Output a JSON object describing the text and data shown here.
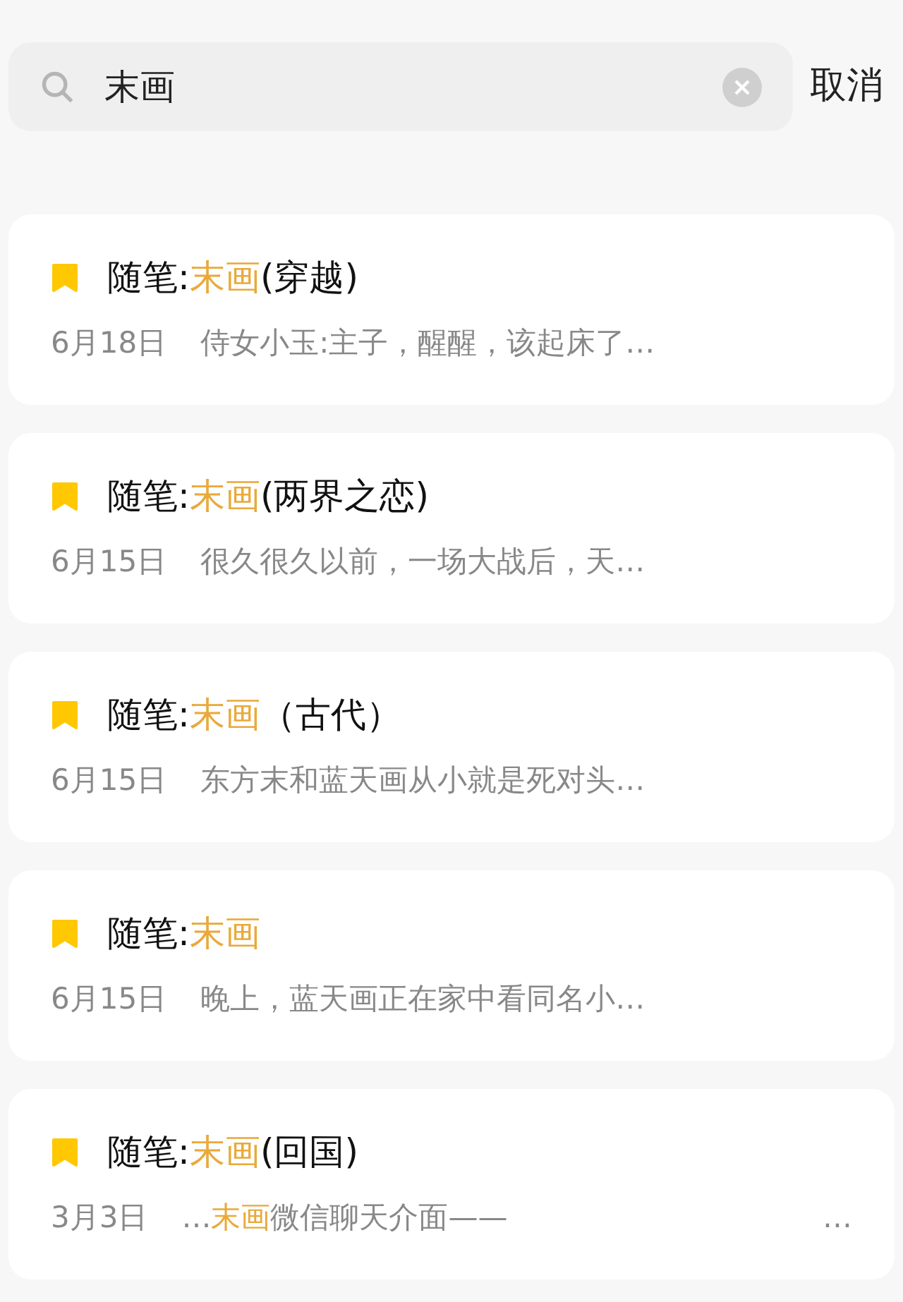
{
  "search": {
    "value": "末画",
    "cancel": "取消"
  },
  "results": [
    {
      "title": [
        {
          "text": "随笔:",
          "highlight": false
        },
        {
          "text": "末画",
          "highlight": true
        },
        {
          "text": "(穿越)",
          "highlight": false
        }
      ],
      "date": "6月18日",
      "snippet": [
        {
          "text": "侍女小玉:主子，醒醒，该起床了…",
          "highlight": false
        }
      ]
    },
    {
      "title": [
        {
          "text": "随笔:",
          "highlight": false
        },
        {
          "text": "末画",
          "highlight": true
        },
        {
          "text": "(两界之恋)",
          "highlight": false
        }
      ],
      "date": "6月15日",
      "snippet": [
        {
          "text": "很久很久以前，一场大战后，天…",
          "highlight": false
        }
      ]
    },
    {
      "title": [
        {
          "text": "随笔:",
          "highlight": false
        },
        {
          "text": "末画",
          "highlight": true
        },
        {
          "text": "（古代）",
          "highlight": false
        }
      ],
      "date": "6月15日",
      "snippet": [
        {
          "text": "东方末和蓝天画从小就是死对头…",
          "highlight": false
        }
      ]
    },
    {
      "title": [
        {
          "text": "随笔:",
          "highlight": false
        },
        {
          "text": "末画",
          "highlight": true
        }
      ],
      "date": "6月15日",
      "snippet": [
        {
          "text": "晚上，蓝天画正在家中看同名小…",
          "highlight": false
        }
      ]
    },
    {
      "title": [
        {
          "text": "随笔:",
          "highlight": false
        },
        {
          "text": "末画",
          "highlight": true
        },
        {
          "text": "(回国)",
          "highlight": false
        }
      ],
      "date": "3月3日",
      "snippet": [
        {
          "text": "…",
          "highlight": false
        },
        {
          "text": "末画",
          "highlight": true
        },
        {
          "text": "微信聊天介面——",
          "highlight": false
        }
      ],
      "more": "…"
    }
  ]
}
